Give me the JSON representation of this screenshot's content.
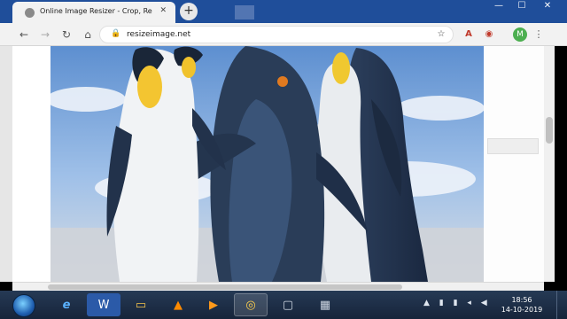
{
  "browser": {
    "tab": {
      "title": "Online Image Resizer - Crop, Re",
      "close": "✕"
    },
    "new_tab": "+",
    "window_controls": {
      "minimize": "—",
      "maximize": "☐",
      "close": "✕"
    },
    "nav": {
      "back": "←",
      "forward": "→",
      "reload": "↻",
      "home": "⌂"
    },
    "address": {
      "lock": "🔒",
      "url": "resizeimage.net"
    },
    "toolbar_icons": {
      "star": "☆",
      "pdf": "A",
      "ext": "◉"
    },
    "profile": {
      "initial": "M"
    },
    "menu": "⋮"
  },
  "page": {
    "image": {
      "subject": "penguins"
    },
    "scroll": {
      "vertical_thumb": "scroll"
    }
  },
  "taskbar": {
    "apps": [
      {
        "name": "ie-icon",
        "glyph": "e"
      },
      {
        "name": "word-icon",
        "glyph": "W"
      },
      {
        "name": "folder-icon",
        "glyph": "▭"
      },
      {
        "name": "vlc-icon",
        "glyph": "▲"
      },
      {
        "name": "media-icon",
        "glyph": "▶"
      },
      {
        "name": "chrome-icon",
        "glyph": "◎"
      },
      {
        "name": "window-icon",
        "glyph": "▢"
      },
      {
        "name": "network-app-icon",
        "glyph": "▦"
      }
    ],
    "tray": "▲ ▮ ▮ ◂ ◀",
    "clock": {
      "time": "18:56",
      "date": "14-10-2019"
    }
  }
}
